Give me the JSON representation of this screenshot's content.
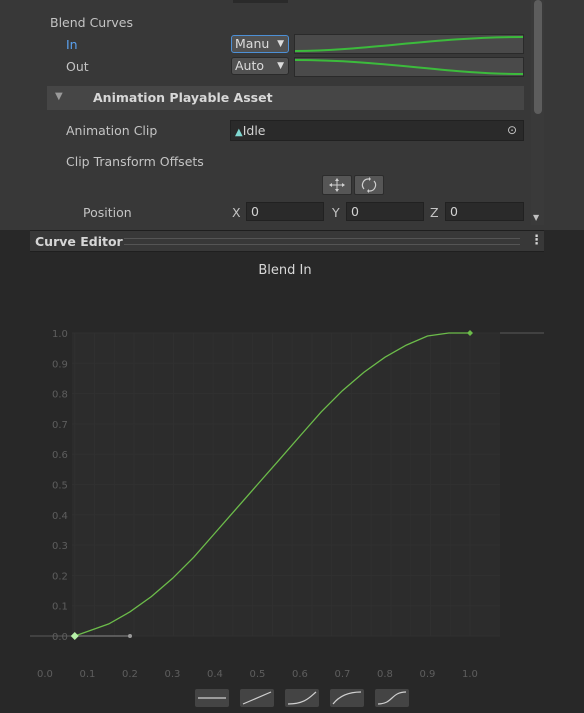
{
  "inspector": {
    "blend_curves_label": "Blend Curves",
    "in_label": "In",
    "out_label": "Out",
    "in_mode": "Manu",
    "out_mode": "Auto",
    "section_title": "Animation Playable Asset",
    "animation_clip_label": "Animation Clip",
    "animation_clip_value": "Idle",
    "clip_transform_offsets_label": "Clip Transform Offsets",
    "position_label": "Position",
    "axes": [
      {
        "axis": "X",
        "value": "0"
      },
      {
        "axis": "Y",
        "value": "0"
      },
      {
        "axis": "Z",
        "value": "0"
      }
    ]
  },
  "curve_editor": {
    "title": "Curve Editor",
    "menu_glyph": "⋮",
    "curve_title": "Blend In",
    "curve_color": "#6cbc4a",
    "accent_color": "#4d90d6"
  },
  "chart_data": {
    "type": "line",
    "title": "Blend In",
    "xlabel": "",
    "ylabel": "",
    "x_ticks": [
      "0.0",
      "0.1",
      "0.2",
      "0.3",
      "0.4",
      "0.5",
      "0.6",
      "0.7",
      "0.8",
      "0.9",
      "1.0"
    ],
    "y_ticks": [
      "0.0",
      "0.1",
      "0.2",
      "0.3",
      "0.4",
      "0.5",
      "0.6",
      "0.7",
      "0.8",
      "0.9",
      "1.0"
    ],
    "xlim": [
      0.0,
      1.0
    ],
    "ylim": [
      0.0,
      1.0
    ],
    "series": [
      {
        "x": [
          0.07,
          0.15,
          0.2,
          0.25,
          0.3,
          0.35,
          0.4,
          0.45,
          0.5,
          0.55,
          0.6,
          0.65,
          0.7,
          0.75,
          0.8,
          0.85,
          0.9,
          0.95,
          1.0
        ],
        "y": [
          0.0,
          0.04,
          0.08,
          0.13,
          0.19,
          0.26,
          0.34,
          0.42,
          0.5,
          0.58,
          0.66,
          0.74,
          0.81,
          0.87,
          0.92,
          0.96,
          0.99,
          1.0,
          1.0
        ]
      }
    ],
    "keyframes": [
      {
        "x": 0.07,
        "y": 0.0
      },
      {
        "x": 1.0,
        "y": 1.0
      }
    ],
    "tangent_handle": {
      "x": 0.2,
      "y": 0.0
    },
    "grid": true
  },
  "presets": [
    "linear-flat",
    "linear",
    "ease-in",
    "ease-out",
    "ease-in-out"
  ]
}
